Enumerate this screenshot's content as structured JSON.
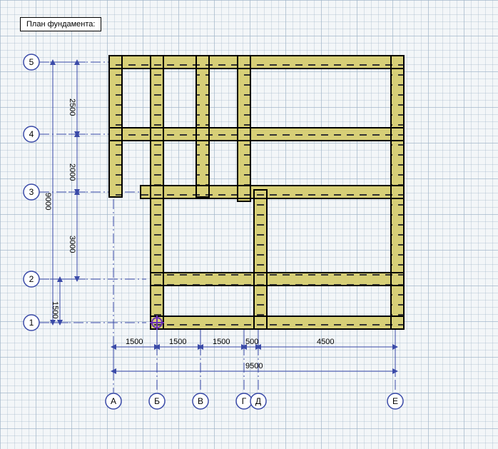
{
  "title": "План фундамента:",
  "axes_y": [
    {
      "mark": "5"
    },
    {
      "mark": "4"
    },
    {
      "mark": "3"
    },
    {
      "mark": "2"
    },
    {
      "mark": "1"
    }
  ],
  "axes_x": [
    {
      "mark": "А"
    },
    {
      "mark": "Б"
    },
    {
      "mark": "В"
    },
    {
      "mark": "Г"
    },
    {
      "mark": "Д"
    },
    {
      "mark": "Е"
    }
  ],
  "dims_y": {
    "d54": "2500",
    "d43": "2000",
    "d32": "3000",
    "d21": "1500",
    "total": "9000"
  },
  "dims_x": {
    "dAB": "1500",
    "dBV": "1500",
    "dVG": "1500",
    "dGD": "500",
    "dDE": "4500",
    "total": "9500"
  }
}
